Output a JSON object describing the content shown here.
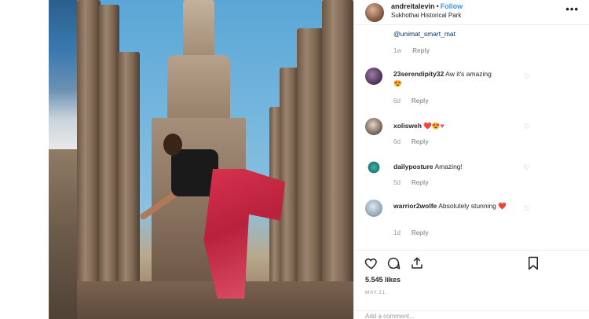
{
  "post": {
    "username": "andreitalevin",
    "separator": "•",
    "follow_label": "Follow",
    "location": "Sukhothai Historical Park",
    "more_icon": "more-options-icon"
  },
  "caption_mention": {
    "text": "@unimat_smart_mat",
    "time": "1w",
    "reply": "Reply"
  },
  "comments": [
    {
      "username": "23serendipity32",
      "text": "Aw it's amazing",
      "emoji": "😍",
      "time": "6d",
      "reply": "Reply"
    },
    {
      "username": "xolisweh",
      "text": "",
      "emoji": "❤️😍♥",
      "time": "6d",
      "reply": "Reply"
    },
    {
      "username": "dailyposture",
      "text": "Amazing!",
      "emoji": "",
      "time": "5d",
      "reply": "Reply"
    },
    {
      "username": "warrior2wolfe",
      "text": "Absolutely stunning",
      "emoji": "❤️",
      "time": "1d",
      "reply": "Reply"
    }
  ],
  "actions": {
    "likes": "5.545 likes",
    "date": "MAY 21",
    "add_comment": "Add a comment..."
  },
  "colors": {
    "follow": "#3897f0",
    "meta_gray": "#999999",
    "heart_red": "#ed4956"
  }
}
